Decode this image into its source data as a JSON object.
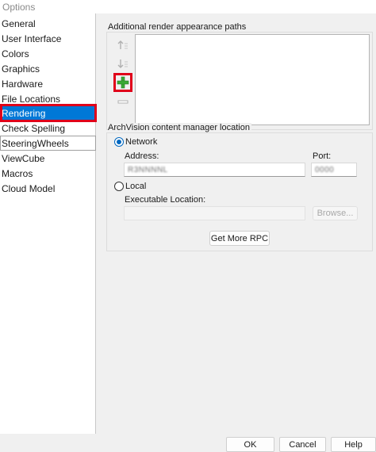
{
  "window": {
    "title": "Options"
  },
  "sidebar": {
    "items": [
      {
        "label": "General"
      },
      {
        "label": "User Interface"
      },
      {
        "label": "Colors"
      },
      {
        "label": "Graphics"
      },
      {
        "label": "Hardware"
      },
      {
        "label": "File Locations"
      },
      {
        "label": "Rendering",
        "selected": true
      },
      {
        "label": "Check Spelling"
      },
      {
        "label": "SteeringWheels"
      },
      {
        "label": "ViewCube"
      },
      {
        "label": "Macros"
      },
      {
        "label": "Cloud Model"
      }
    ]
  },
  "appearance_paths": {
    "title": "Additional render appearance paths",
    "toolbar": {
      "move_up_icon": "arrow-up-list-icon",
      "move_down_icon": "arrow-down-list-icon",
      "add_icon": "plus-icon",
      "remove_icon": "minus-icon"
    }
  },
  "archvision": {
    "title": "ArchVision content manager location",
    "network": {
      "label": "Network",
      "selected": true,
      "address_label": "Address:",
      "address_value": "R3NNNNL",
      "port_label": "Port:",
      "port_value": "0000"
    },
    "local": {
      "label": "Local",
      "selected": false,
      "executable_label": "Executable Location:",
      "executable_value": "",
      "browse_label": "Browse..."
    },
    "get_more_label": "Get More RPC"
  },
  "footer": {
    "ok_label": "OK",
    "cancel_label": "Cancel",
    "help_label": "Help"
  },
  "colors": {
    "selection": "#0078d7",
    "highlight": "#e0001a",
    "add_icon": "#39a935"
  }
}
